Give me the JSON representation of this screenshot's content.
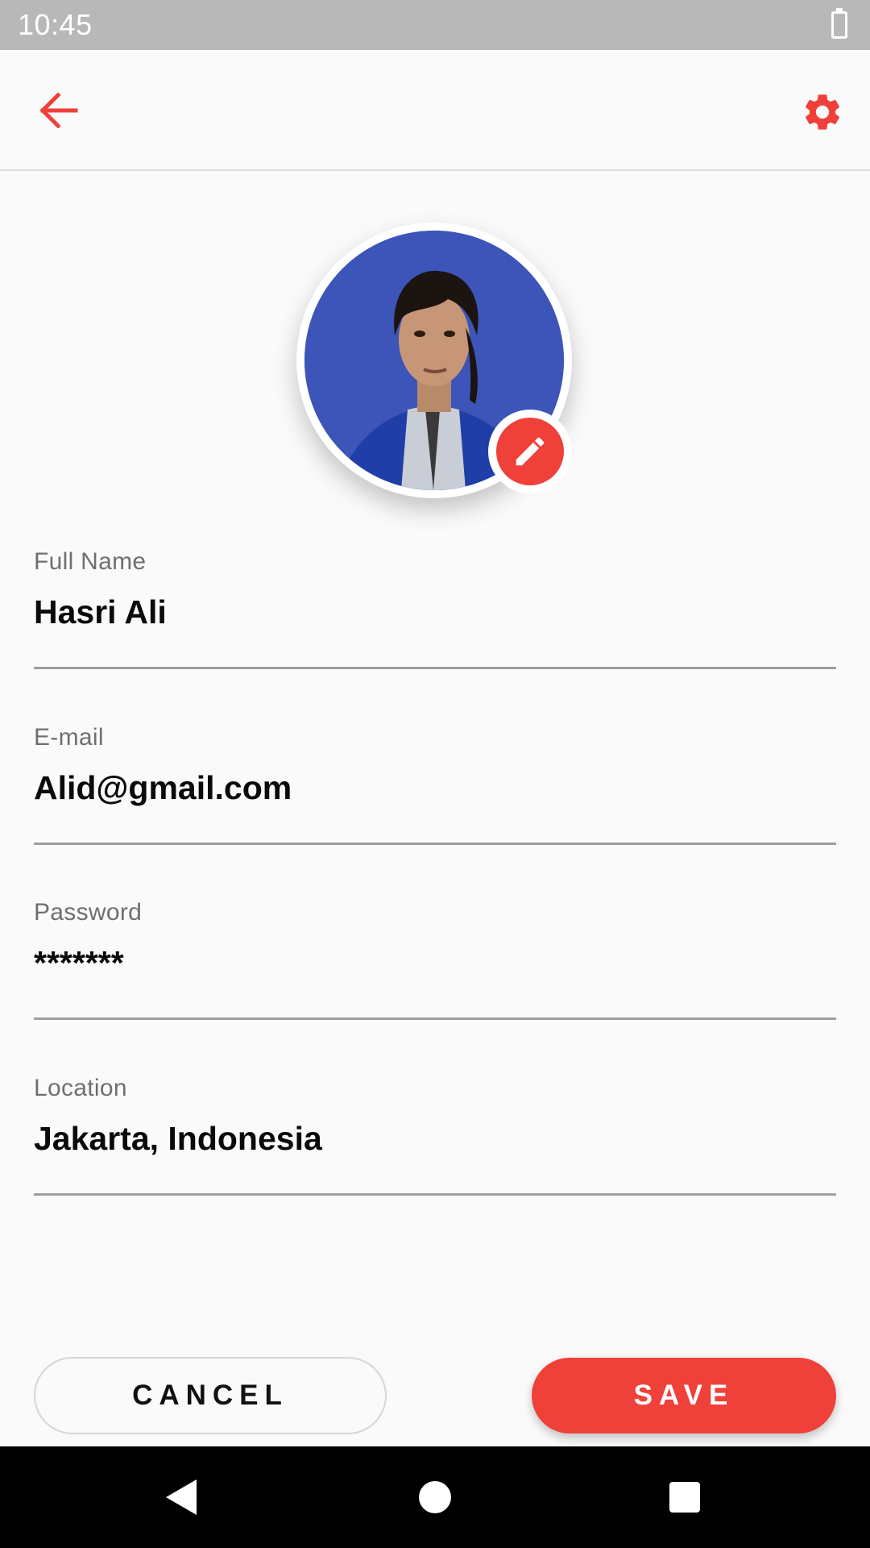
{
  "status_bar": {
    "time": "10:45",
    "battery_icon": "battery-icon"
  },
  "app_bar": {
    "back_icon": "arrow-left-icon",
    "settings_icon": "gear-icon"
  },
  "profile": {
    "edit_icon": "pencil-icon"
  },
  "fields": {
    "full_name": {
      "label": "Full Name",
      "value": "Hasri Ali"
    },
    "email": {
      "label": "E-mail",
      "value": "Alid@gmail.com"
    },
    "password": {
      "label": "Password",
      "value": "*******"
    },
    "location": {
      "label": "Location",
      "value": "Jakarta, Indonesia"
    }
  },
  "actions": {
    "cancel_label": "CANCEL",
    "save_label": "SAVE"
  },
  "nav": {
    "back": "nav-back-icon",
    "home": "nav-home-icon",
    "recents": "nav-recents-icon"
  },
  "colors": {
    "accent": "#f0403a",
    "status_bar": "#b8b8b8",
    "background": "#fafafa"
  }
}
